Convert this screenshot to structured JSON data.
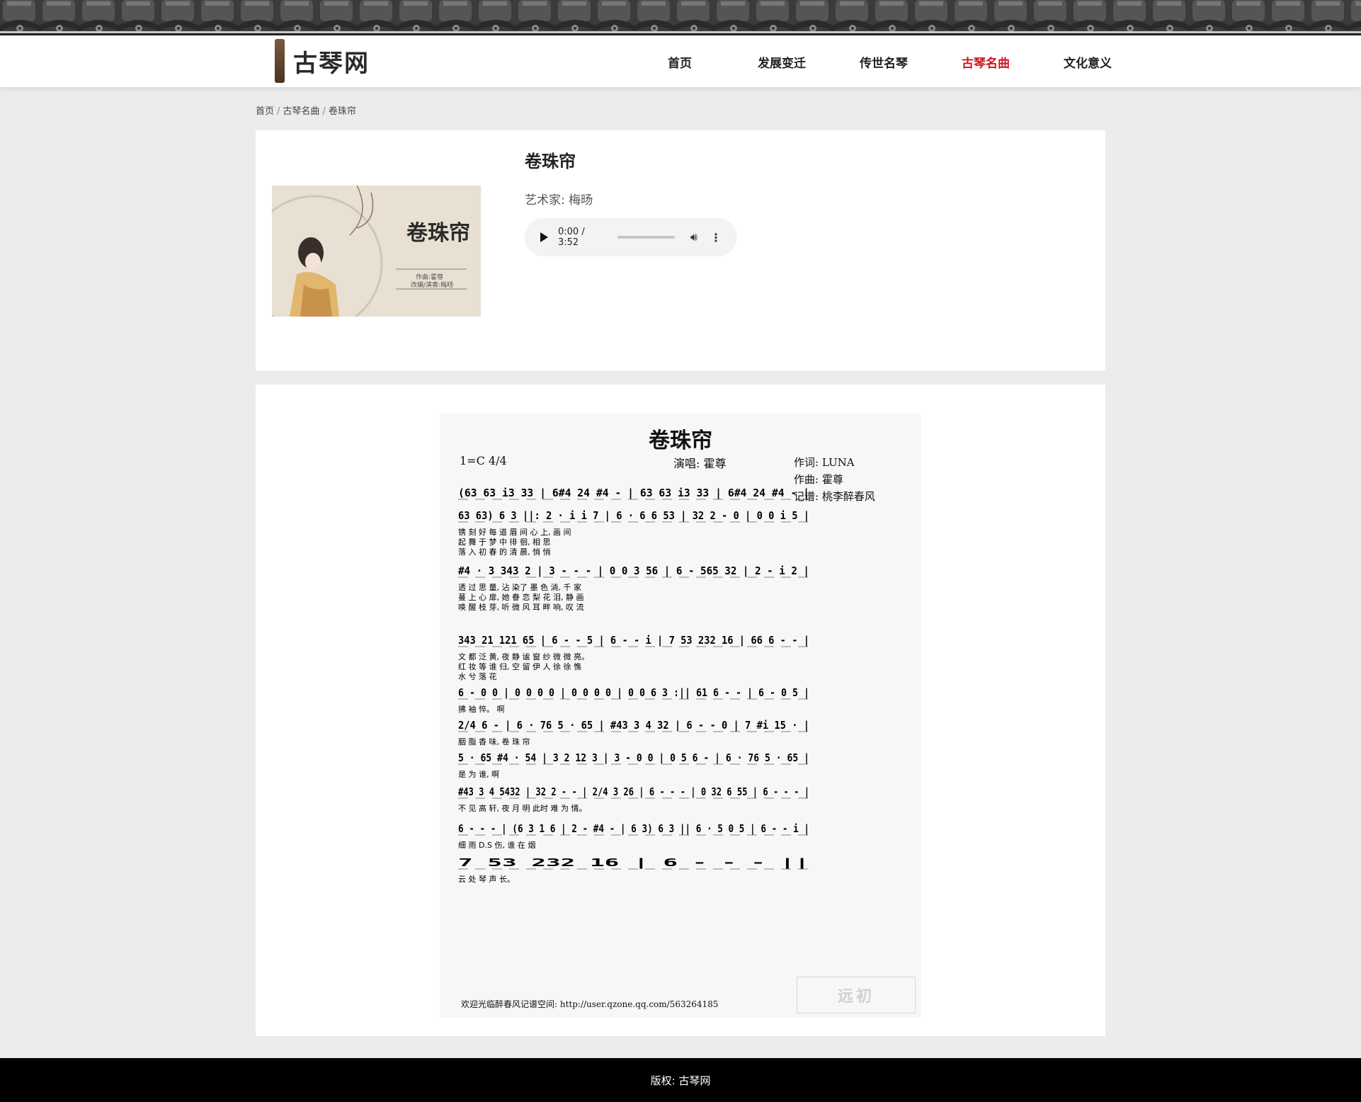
{
  "site": {
    "logo_text": "古琴网"
  },
  "nav": {
    "items": [
      "首页",
      "发展变迁",
      "传世名琴",
      "古琴名曲",
      "文化意义"
    ],
    "active_index": 3,
    "active_color": "#d0161c"
  },
  "breadcrumb": {
    "items": [
      "首页",
      "古琴名曲",
      "卷珠帘"
    ],
    "separator": "/"
  },
  "song": {
    "title": "卷珠帘",
    "artist_label": "艺术家: ",
    "artist": "梅旸",
    "cover": {
      "title": "卷珠帘",
      "line1": "作曲:霍尊",
      "line2": "改编/演奏:梅旸"
    }
  },
  "player": {
    "current_time": "0:00",
    "duration": "3:52",
    "time_text": "0:00 / 3:52",
    "progress": 0
  },
  "sheet": {
    "title": "卷珠帘",
    "key": "1=C 4/4",
    "singer": "演唱: 霍尊",
    "lyricist": "作词: LUNA",
    "composer": "作曲: 霍尊",
    "transcriber": "记谱: 桃李醉春风",
    "footer": "欢迎光临醉春风记谱空间: http://user.qzone.qq.com/563264185",
    "watermark": "远初",
    "rows": [
      {
        "notes": "(63 63 i3 33 | 6#4 24 #4 - | 63 63 i3 33 | 6#4 24 #4 - |",
        "lyrics": []
      },
      {
        "notes": "63 63) 6 3 ||: 2 · i i 7 | 6 · 6 6 53 | 32 2 - 0 | 0 0 i 5 |",
        "lyrics": [
          "镌 刻 好 每 道 眉 间 心 上, 画 间",
          "起 舞 于 梦 中 徘 徊, 相 思",
          "落 入 初 春 的 清 晨, 悄 悄"
        ]
      },
      {
        "notes": "#4 · 3 343 2 | 3 - - - | 0 0 3 56 | 6 - 565 32 | 2 - i 2 |",
        "lyrics": [
          "透 过 思 量, 沾 染了 墨 色 淌, 千 家",
          "蔓 上 心 扉, 她 眷 恋 梨 花 泪, 静 画",
          "唤 醒 枝 芽, 听 微 风 耳 畔 响, 叹 流"
        ]
      },
      {
        "notes": "343 21 121 65 | 6 - - 5 | 6 - - i | 7 53 232 16 | 66 6 - - |",
        "lyrics": [
          "文 都 泛 黄, 夜 静 谧 窗 纱 微 微 亮。",
          "红 妆 等 谁 归, 空 留 伊 人 徐 徐 憔",
          "水 兮 落 花"
        ]
      },
      {
        "notes": "6 - 0 0 | 0 0 0 0 | 0 0 0 0 | 0 0 6 3 :|| 61 6 - - | 6 - 0 5 |",
        "lyrics": [
          "拂 袖 悴。 啊"
        ]
      },
      {
        "notes": "2/4 6 - | 6 · 76 5 · 65 | #43 3 4 32 | 6 - - 0 | 7 #i 15 · |",
        "lyrics": [
          "胭 脂 香 味, 卷 珠 帘"
        ]
      },
      {
        "notes": "5 · 65 #4 · 54 | 3 2 12 3 | 3 - 0 0 | 0 5 6 - | 6 · 76 5 · 65 |",
        "lyrics": [
          "是 为 谁, 啊"
        ]
      },
      {
        "notes": "#43 3 4 5432 | 32 2 - - | 2/4 3 26 | 6 - - - | 0 32 6 55 | 6 - - - |",
        "lyrics": [
          "不 见 高 轩, 夜 月 明 此时 难 为 情。"
        ]
      },
      {
        "notes": "6 - - - | (6 3 1 6 | 2 - #4 - | 6 3) 6 3 || 6 · 5 0 5 | 6 - - i |",
        "lyrics": [
          "细 雨 D.S 伤, 谁 在 烟"
        ]
      },
      {
        "notes": "7 53 232 16 | 6 - - - ||",
        "lyrics": [
          "云 处 琴 声 长。"
        ]
      }
    ]
  },
  "footer": {
    "copyright": "版权: 古琴网"
  }
}
